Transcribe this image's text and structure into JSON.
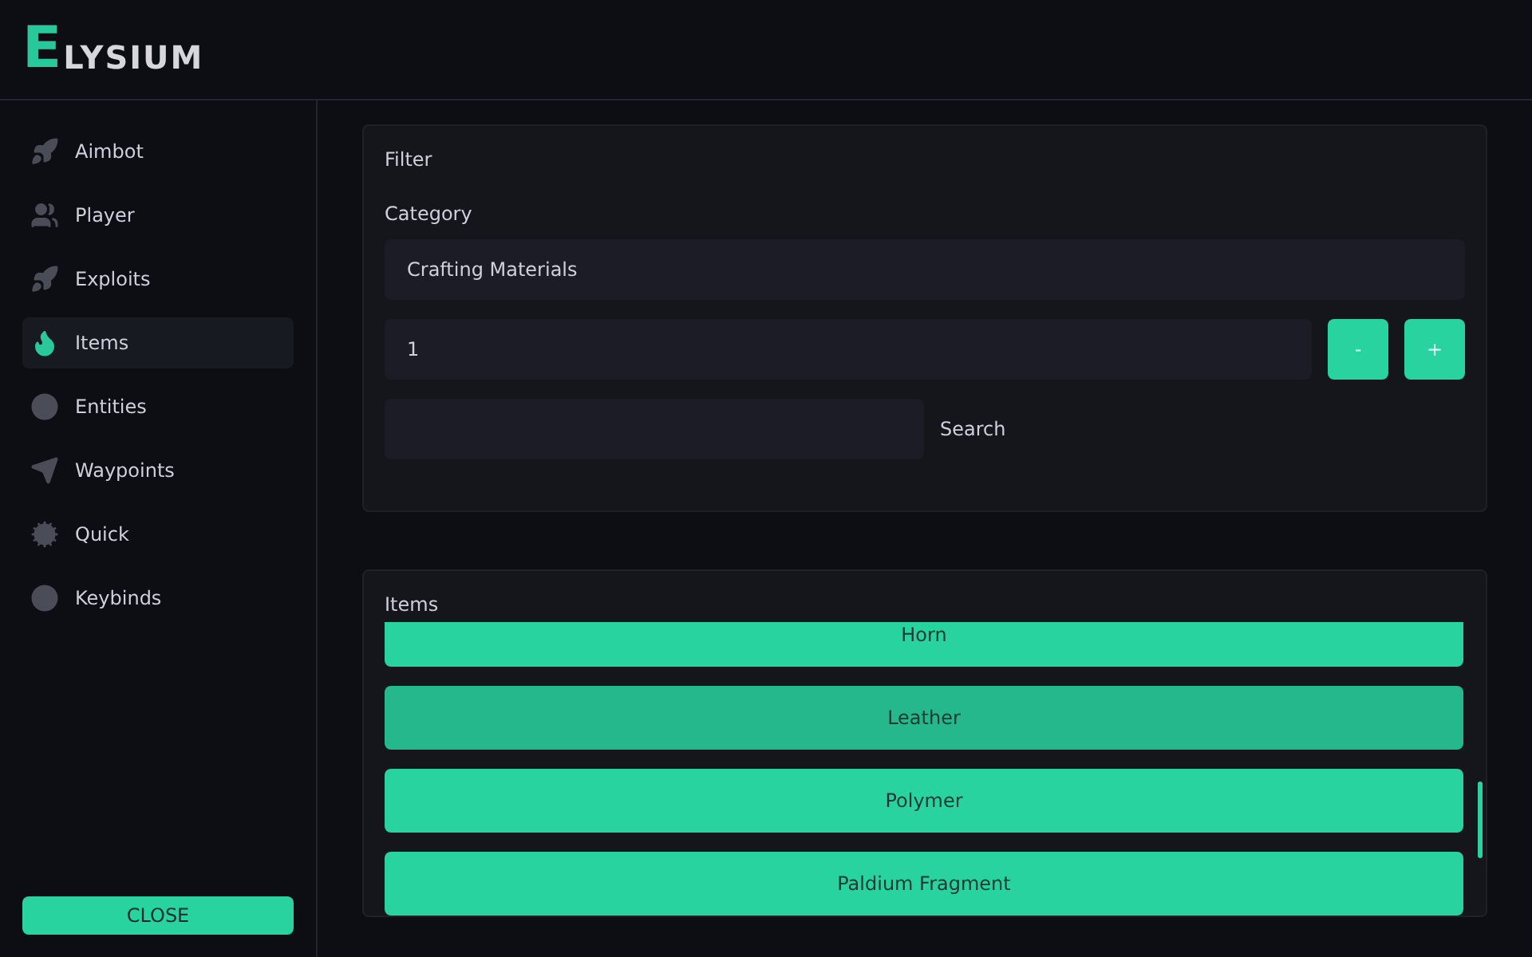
{
  "logo": {
    "mark": "E",
    "text": "LYSIUM"
  },
  "sidebar": {
    "items": [
      {
        "label": "Aimbot",
        "selected": false
      },
      {
        "label": "Player",
        "selected": false
      },
      {
        "label": "Exploits",
        "selected": false
      },
      {
        "label": "Items",
        "selected": true
      },
      {
        "label": "Entities",
        "selected": false
      },
      {
        "label": "Waypoints",
        "selected": false
      },
      {
        "label": "Quick",
        "selected": false
      },
      {
        "label": "Keybinds",
        "selected": false
      }
    ],
    "close_button": "CLOSE"
  },
  "filter": {
    "title": "Filter",
    "category_label": "Category",
    "category_value": "Crafting Materials",
    "amount_value": "1",
    "minus": "-",
    "plus": "+",
    "search_button": "Search"
  },
  "items": {
    "title": "Items",
    "list": [
      {
        "label": "Horn",
        "hovered": false
      },
      {
        "label": "Leather",
        "hovered": true
      },
      {
        "label": "Polymer",
        "hovered": false
      },
      {
        "label": "Paldium Fragment",
        "hovered": false
      }
    ]
  }
}
